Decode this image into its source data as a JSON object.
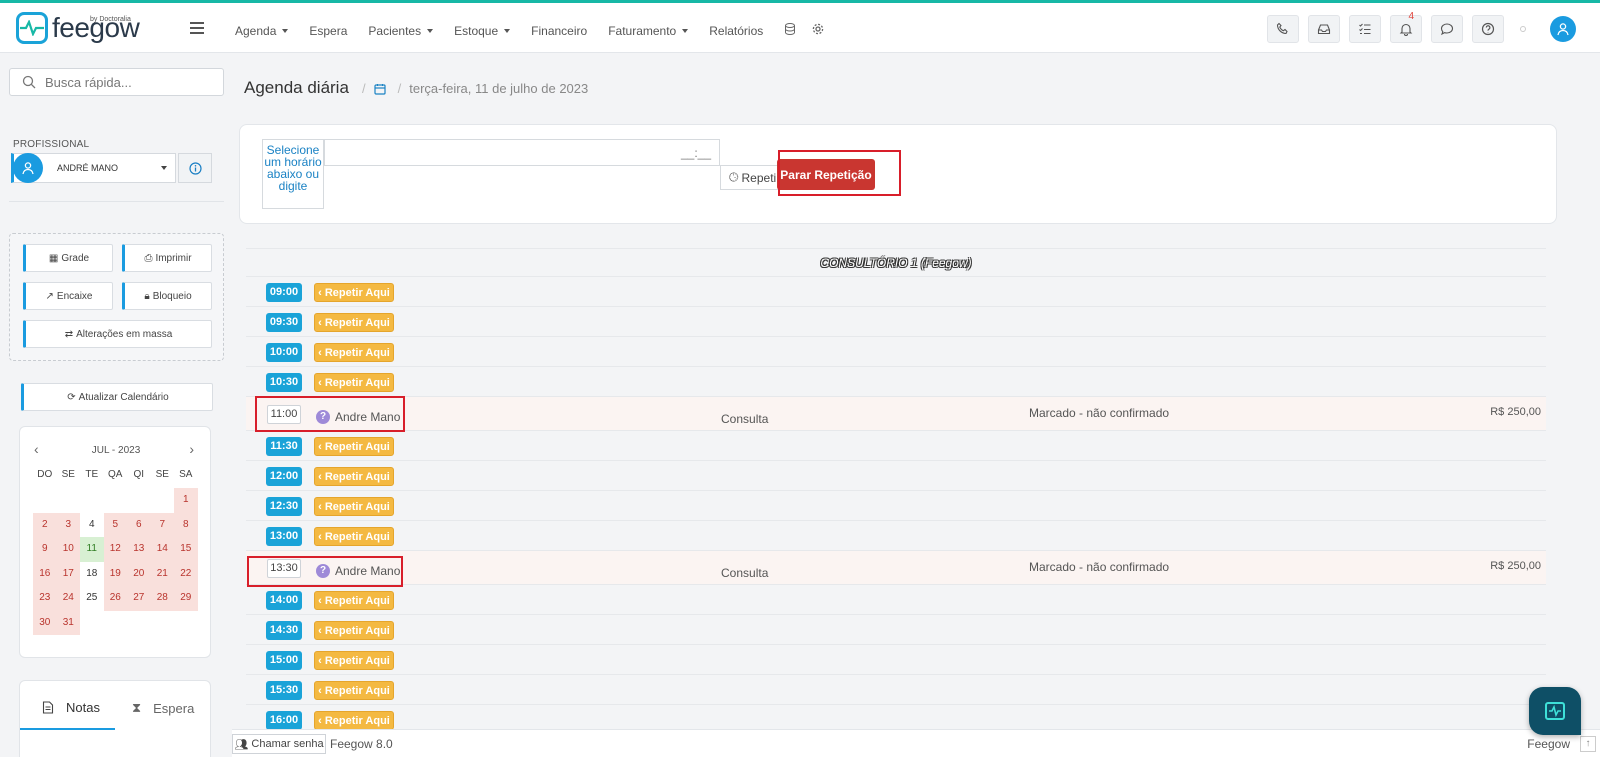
{
  "brand": {
    "logo_text": "feegow",
    "logo_sub": "by Doctoralia"
  },
  "topnav": {
    "items": [
      {
        "label": "Agenda",
        "dropdown": true
      },
      {
        "label": "Espera",
        "dropdown": false
      },
      {
        "label": "Pacientes",
        "dropdown": true
      },
      {
        "label": "Estoque",
        "dropdown": true
      },
      {
        "label": "Financeiro",
        "dropdown": false
      },
      {
        "label": "Faturamento",
        "dropdown": true
      },
      {
        "label": "Relatórios",
        "dropdown": false
      }
    ],
    "notification_count": "4"
  },
  "sidebar": {
    "search_placeholder": "Busca rápida...",
    "professional_label": "PROFISSIONAL",
    "professional_name": "ANDRÉ MANO",
    "tools": {
      "grade": "Grade",
      "imprimir": "Imprimir",
      "encaixe": "Encaixe",
      "bloqueio": "Bloqueio",
      "alteracoes": "Alterações em massa"
    },
    "refresh_label": "Atualizar Calendário",
    "calendar": {
      "month_label": "JUL - 2023",
      "dows": [
        "DO",
        "SE",
        "TE",
        "QA",
        "QI",
        "SE",
        "SA"
      ],
      "days": [
        {
          "d": "",
          "k": "e"
        },
        {
          "d": "",
          "k": "e"
        },
        {
          "d": "",
          "k": "e"
        },
        {
          "d": "",
          "k": "e"
        },
        {
          "d": "",
          "k": "e"
        },
        {
          "d": "",
          "k": "e"
        },
        {
          "d": "1",
          "k": "d"
        },
        {
          "d": "2",
          "k": "d"
        },
        {
          "d": "3",
          "k": "d"
        },
        {
          "d": "4",
          "k": "w"
        },
        {
          "d": "5",
          "k": "d"
        },
        {
          "d": "6",
          "k": "d"
        },
        {
          "d": "7",
          "k": "d"
        },
        {
          "d": "8",
          "k": "d"
        },
        {
          "d": "9",
          "k": "d"
        },
        {
          "d": "10",
          "k": "d"
        },
        {
          "d": "11",
          "k": "t"
        },
        {
          "d": "12",
          "k": "d"
        },
        {
          "d": "13",
          "k": "d"
        },
        {
          "d": "14",
          "k": "d"
        },
        {
          "d": "15",
          "k": "d"
        },
        {
          "d": "16",
          "k": "d"
        },
        {
          "d": "17",
          "k": "d"
        },
        {
          "d": "18",
          "k": "w"
        },
        {
          "d": "19",
          "k": "d"
        },
        {
          "d": "20",
          "k": "d"
        },
        {
          "d": "21",
          "k": "d"
        },
        {
          "d": "22",
          "k": "d"
        },
        {
          "d": "23",
          "k": "d"
        },
        {
          "d": "24",
          "k": "d"
        },
        {
          "d": "25",
          "k": "w"
        },
        {
          "d": "26",
          "k": "d"
        },
        {
          "d": "27",
          "k": "d"
        },
        {
          "d": "28",
          "k": "d"
        },
        {
          "d": "29",
          "k": "d"
        },
        {
          "d": "30",
          "k": "d"
        },
        {
          "d": "31",
          "k": "d"
        }
      ]
    },
    "notes_tab": "Notas",
    "wait_tab": "Espera"
  },
  "main": {
    "title": "Agenda diária",
    "date": "terça-feira, 11 de julho de 2023",
    "select_hint": "Selecione um horário abaixo ou digite",
    "time_mask": "__:__",
    "repeat_label": "Repetir",
    "stop_repeat_label": "Parar Repetição",
    "room_title": "CONSULTÓRIO 1 (Feegow)",
    "repeat_here_label": "Repetir Aqui",
    "slots": [
      {
        "time": "09:00",
        "booked": false
      },
      {
        "time": "09:30",
        "booked": false
      },
      {
        "time": "10:00",
        "booked": false
      },
      {
        "time": "10:30",
        "booked": false
      },
      {
        "time": "11:00",
        "booked": true,
        "patient": "Andre Mano",
        "procedure": "Consulta",
        "status": "Marcado - não confirmado",
        "price": "R$ 250,00"
      },
      {
        "time": "11:30",
        "booked": false
      },
      {
        "time": "12:00",
        "booked": false
      },
      {
        "time": "12:30",
        "booked": false
      },
      {
        "time": "13:00",
        "booked": false
      },
      {
        "time": "13:30",
        "booked": true,
        "patient": "Andre Mano",
        "procedure": "Consulta",
        "status": "Marcado - não confirmado",
        "price": "R$ 250,00"
      },
      {
        "time": "14:00",
        "booked": false
      },
      {
        "time": "14:30",
        "booked": false
      },
      {
        "time": "15:00",
        "booked": false
      },
      {
        "time": "15:30",
        "booked": false
      },
      {
        "time": "16:00",
        "booked": false
      }
    ]
  },
  "footer": {
    "call_label": "Chamar senha",
    "version": "Feegow 8.0",
    "brand": "Feegow"
  },
  "colors": {
    "accent": "#1aa3d8",
    "repeat_here": "#f4b942",
    "stop_repeat": "#c93630",
    "highlight": "#d81e2a"
  }
}
